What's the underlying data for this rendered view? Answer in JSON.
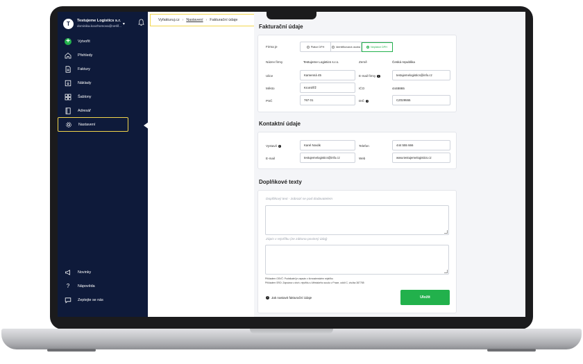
{
  "sidebar": {
    "account": {
      "avatar_letter": "T",
      "name": "Testujeme Logistics s.r.",
      "email": "dominika.koozhomova@netlif..."
    },
    "items": [
      {
        "label": "Vytvořit",
        "icon": "plus-circle-icon"
      },
      {
        "label": "Přehledy",
        "icon": "home-icon"
      },
      {
        "label": "Faktury",
        "icon": "document-icon"
      },
      {
        "label": "Náklady",
        "icon": "expense-icon"
      },
      {
        "label": "Šablony",
        "icon": "grid-icon"
      },
      {
        "label": "Adresář",
        "icon": "book-icon"
      },
      {
        "label": "Nastavení",
        "icon": "gear-icon"
      }
    ],
    "bottom_items": [
      {
        "label": "Novinky",
        "icon": "megaphone-icon"
      },
      {
        "label": "Nápověda",
        "icon": "question-icon"
      },
      {
        "label": "Zeptejte se nás",
        "icon": "chat-icon"
      }
    ]
  },
  "breadcrumb": {
    "root": "Vyfakturuj.cz",
    "section": "Nastavení",
    "current": "Fakturační údaje"
  },
  "billing": {
    "title": "Fakturační údaje",
    "firm_label": "Firma je",
    "firm_options": [
      "Plátce DPH",
      "Identifikovaná osoba",
      "Neplátce DPH"
    ],
    "selected_option": "Neplátce DPH",
    "name_label": "Název firmy",
    "name_value": "Testujeme Logistics s.r.o.",
    "country_label": "Země",
    "country_value": "Česká republika",
    "street_label": "Ulice",
    "street_value": "Kamenná 45",
    "email_label": "E-mail firmy",
    "email_value": "testujemelogistics@info.cz",
    "city_label": "Město",
    "city_value": "Kroměříž",
    "ico_label": "IČO",
    "ico_value": "4448865",
    "zip_label": "PSČ",
    "zip_value": "767 01",
    "dic_label": "DIČ",
    "dic_value": "CZ029555"
  },
  "contact": {
    "title": "Kontaktní údaje",
    "issued_label": "Vystavil",
    "issued_value": "Karel Novák",
    "phone_label": "Telefon",
    "phone_value": "444 555 666",
    "email_label": "E-mail",
    "email_value": "testujemelogistics@info.cz",
    "web_label": "Web",
    "web_value": "www.testujemelogistics.cz"
  },
  "extra": {
    "title": "Doplňkové texty",
    "textarea1_placeholder": "Doplňkový text - zobrazí se pod dodavatelem",
    "textarea2_placeholder": "Zápis v rejstříku (ze zákona povinný údaj)",
    "note1": "Příkladem OSVČ: Podnikatel je zapsán v živnostenském rejstříku",
    "note2": "Příkladem SRO: Zapsána v obch. rejstříku u Městského soudu v Praze, oddíl C, vložka 387785",
    "help_text": "Jak nastavit fakturační údaje",
    "save_label": "Uložit"
  },
  "colors": {
    "sidebar_bg": "#0e1a3a",
    "accent_green": "#22b14c",
    "highlight_yellow": "#f2d64b"
  }
}
